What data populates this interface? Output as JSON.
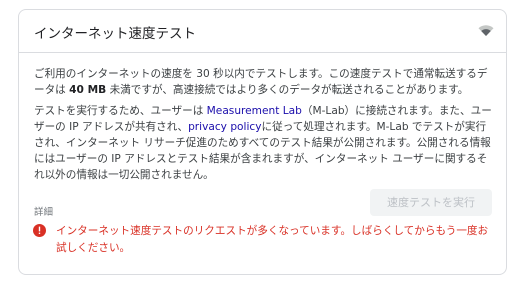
{
  "card": {
    "title": "インターネット速度テスト",
    "wifi_icon": "wifi-icon"
  },
  "intro": {
    "part1": "ご利用のインターネットの速度を 30 秒以内でテストします。この速度テストで通常転送するデータは ",
    "data_amount": "40 MB",
    "part2": " 未満ですが、高速接続ではより多くのデータが転送されることがあります。"
  },
  "privacy": {
    "part1": "テストを実行するため、ユーザーは ",
    "mlab_link": "Measurement Lab",
    "part2": "（M-Lab）に接続されます。また、ユーザーの IP アドレスが共有され、",
    "policy_link": "privacy policy",
    "part3": "に従って処理されます。M-Lab でテストが実行され、インターネット リサーチ促進のためすべてのテスト結果が公開されます。公開される情報にはユーザーの IP アドレスとテスト結果が含まれますが、インターネット ユーザーに関するそれ以外の情報は一切公開されません。"
  },
  "actions": {
    "details_label": "詳細",
    "run_button_label": "速度テストを実行"
  },
  "error": {
    "message": "インターネット速度テストのリクエストが多くなっています。しばらくしてからもう一度お試しください。",
    "color": "#d93025"
  },
  "colors": {
    "link": "#1a0dab",
    "border": "#dadce0",
    "button_bg": "#f1f3f4",
    "button_text_disabled": "#bdc1c6"
  }
}
